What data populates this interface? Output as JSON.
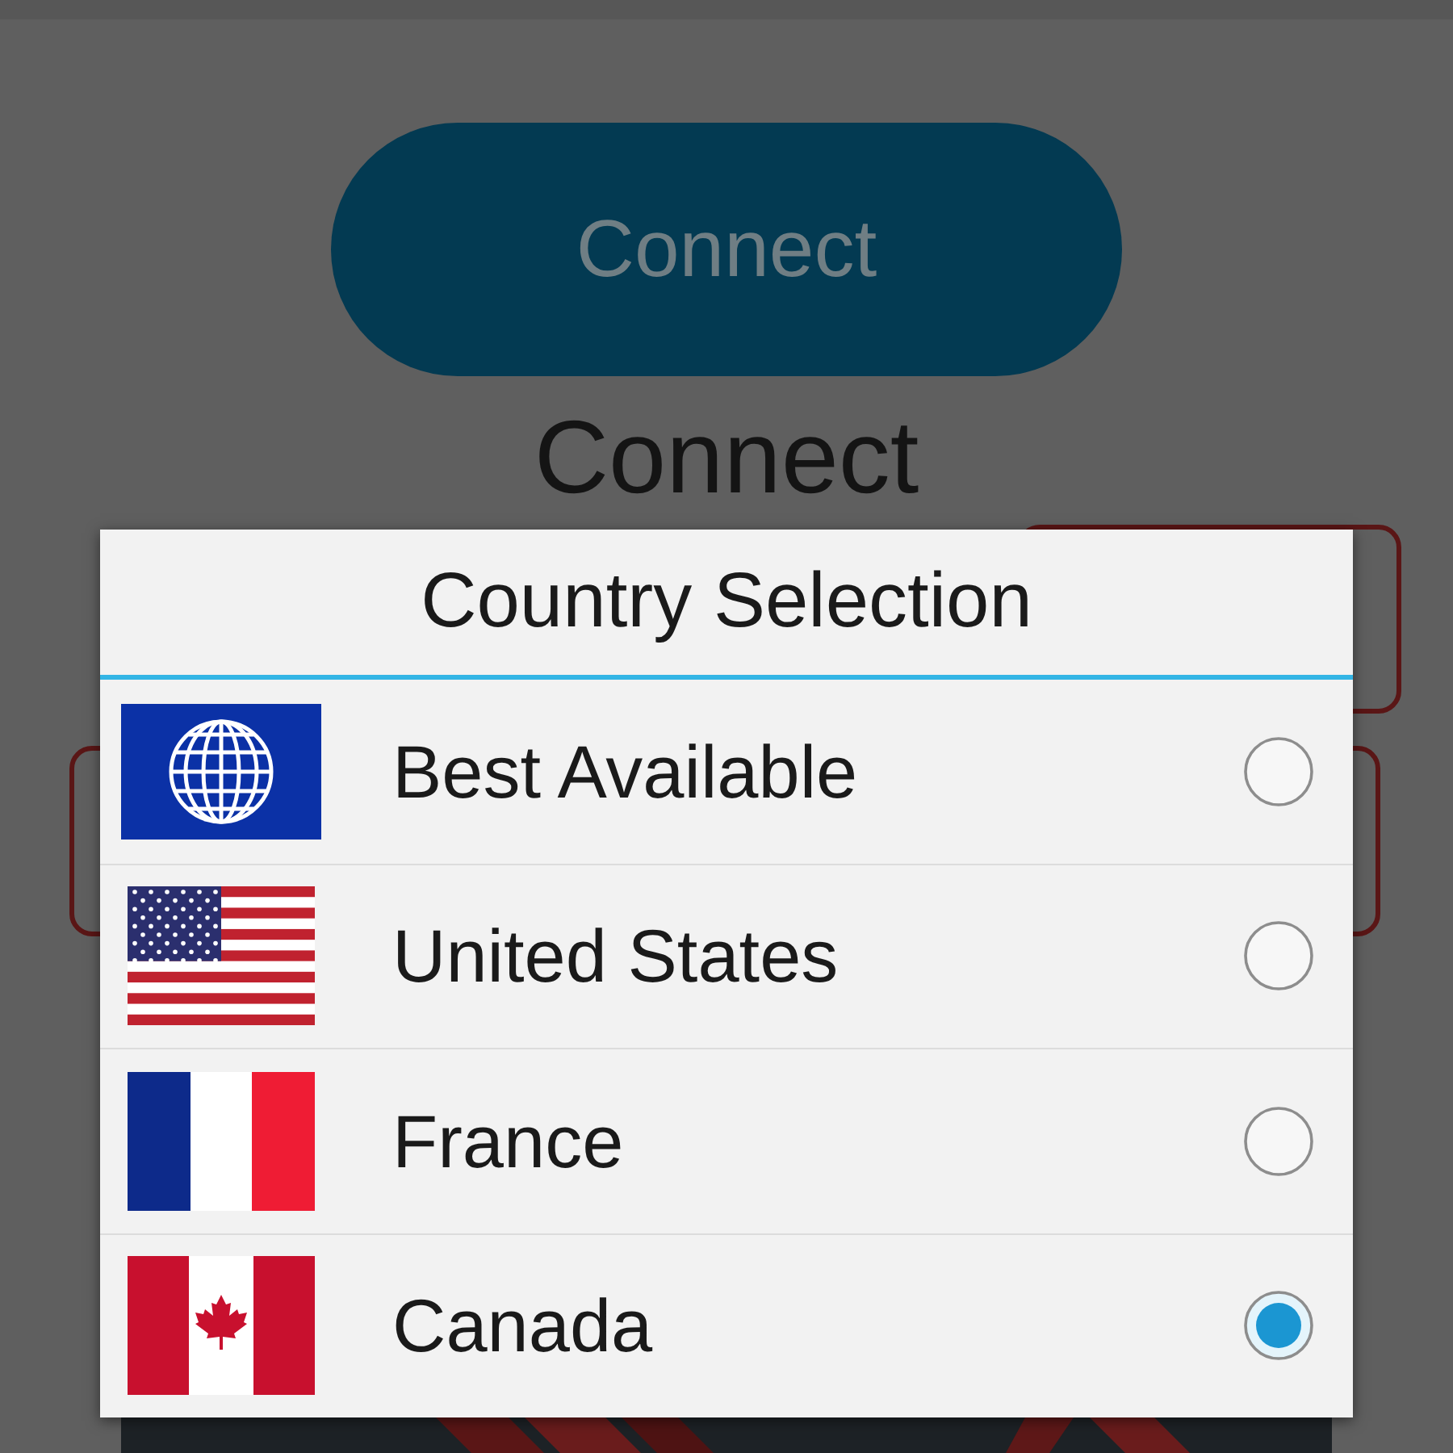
{
  "connect_button": {
    "label": "Connect"
  },
  "status_text": "Connect",
  "country_dialog": {
    "title": "Country Selection",
    "options": [
      {
        "kind": "globe",
        "label": "Best Available",
        "selected": false
      },
      {
        "kind": "us",
        "label": "United States",
        "selected": false
      },
      {
        "kind": "france",
        "label": "France",
        "selected": false
      },
      {
        "kind": "canada",
        "label": "Canada",
        "selected": true
      }
    ]
  }
}
